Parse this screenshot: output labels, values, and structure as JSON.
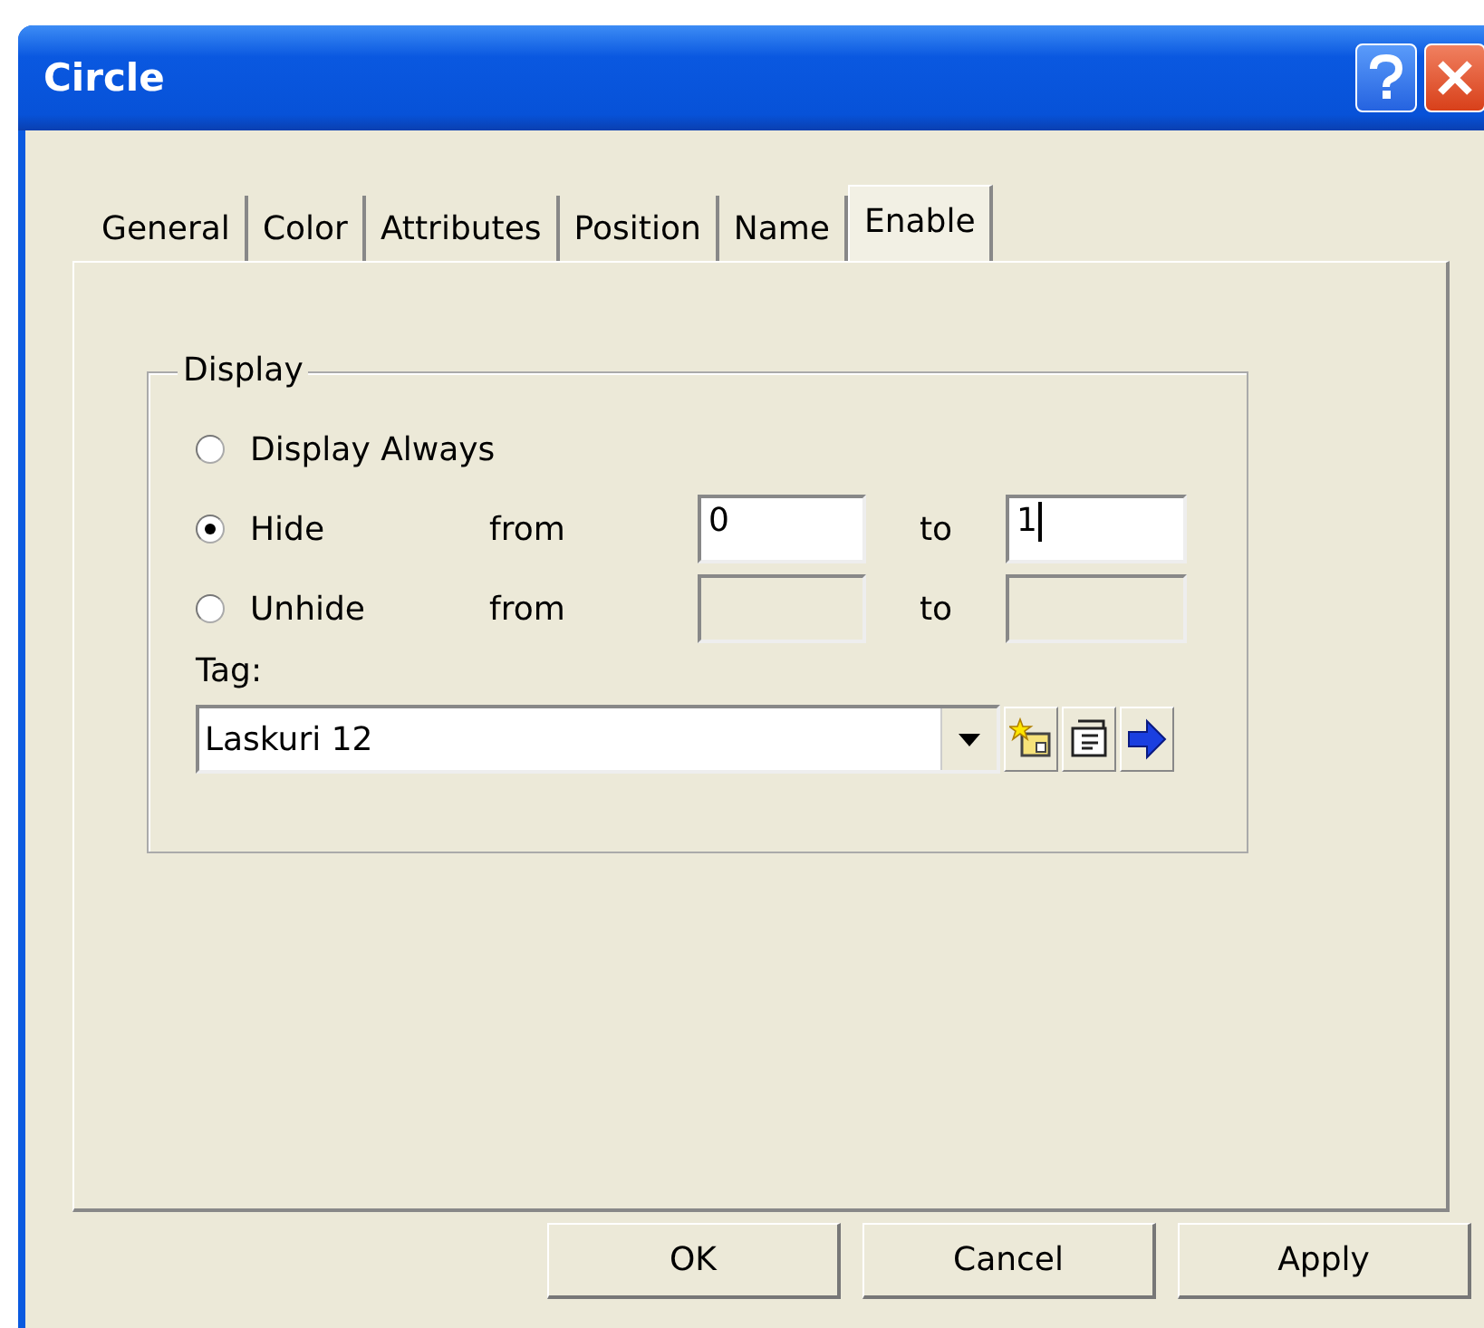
{
  "window": {
    "title": "Circle"
  },
  "tabs": [
    {
      "label": "General",
      "selected": false
    },
    {
      "label": "Color",
      "selected": false
    },
    {
      "label": "Attributes",
      "selected": false
    },
    {
      "label": "Position",
      "selected": false
    },
    {
      "label": "Name",
      "selected": false
    },
    {
      "label": "Enable",
      "selected": true
    }
  ],
  "group": {
    "title": "Display"
  },
  "options": [
    {
      "kind": "plain",
      "label": "Display Always",
      "selected": false
    },
    {
      "kind": "range",
      "label": "Hide",
      "selected": true,
      "disabled": false,
      "from_label": "from",
      "from_value": "0",
      "to_label": "to",
      "to_value": "1",
      "to_focused": true
    },
    {
      "kind": "range",
      "label": "Unhide",
      "selected": false,
      "disabled": true,
      "from_label": "from",
      "to_label": "to"
    }
  ],
  "tag": {
    "label": "Tag:",
    "value": "Laskuri 12"
  },
  "buttons": [
    "OK",
    "Cancel",
    "Apply"
  ]
}
